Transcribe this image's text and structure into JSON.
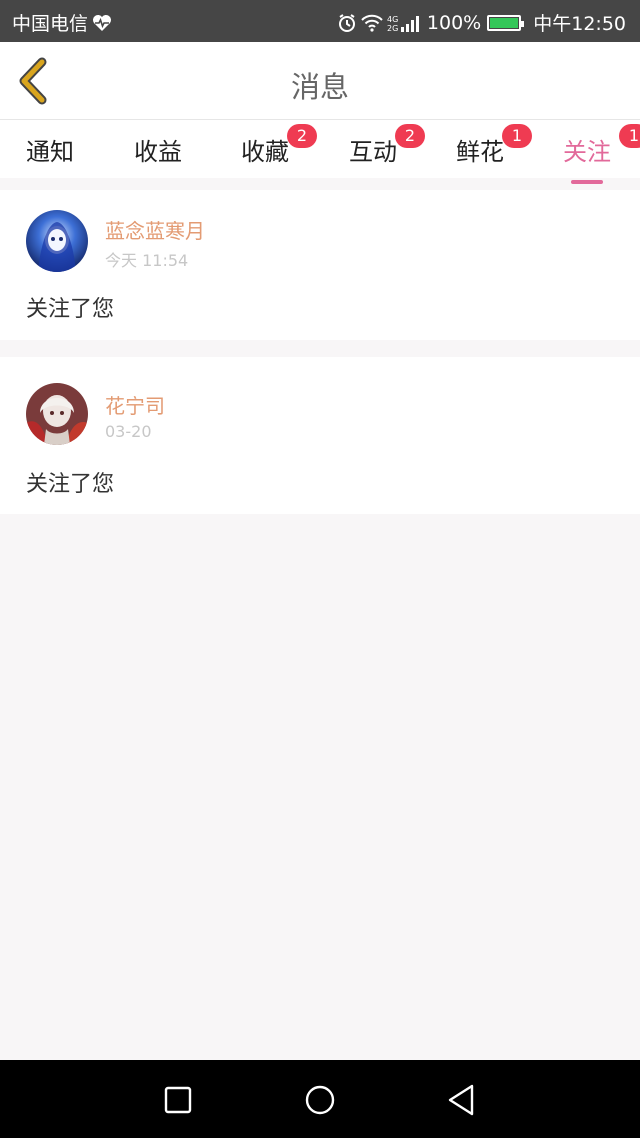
{
  "status_bar": {
    "carrier": "中国电信",
    "battery_percent": "100%",
    "time": "中午12:50",
    "network": "4G"
  },
  "header": {
    "title": "消息"
  },
  "tabs": [
    {
      "label": "通知",
      "badge": ""
    },
    {
      "label": "收益",
      "badge": ""
    },
    {
      "label": "收藏",
      "badge": "2"
    },
    {
      "label": "互动",
      "badge": "2"
    },
    {
      "label": "鲜花",
      "badge": "1"
    },
    {
      "label": "关注",
      "badge": "1",
      "active": true
    }
  ],
  "items": [
    {
      "name": "蓝念蓝寒月",
      "time": "今天 11:54",
      "message": "关注了您"
    },
    {
      "name": "花宁司",
      "time": "03-20",
      "message": "关注了您"
    }
  ],
  "colors": {
    "accent": "#e2699a",
    "username": "#e39b73",
    "badge": "#ef3b52",
    "back_arrow": "#d9a51e"
  }
}
